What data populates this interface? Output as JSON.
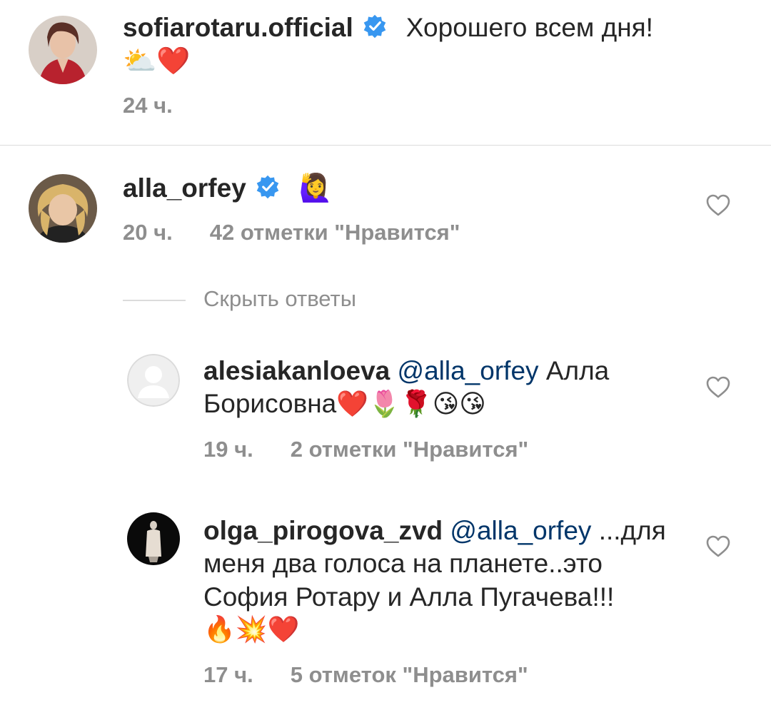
{
  "post": {
    "username": "sofiarotaru.official",
    "caption": "Хорошего всем дня!",
    "caption_emoji": "⛅❤️",
    "time": "24 ч."
  },
  "comment": {
    "username": "alla_orfey",
    "emoji": "🙋‍♀️",
    "time": "20 ч.",
    "likes": "42 отметки \"Нравится\""
  },
  "hide_replies": "Скрыть ответы",
  "replies": [
    {
      "username": "alesiakanloeva",
      "mention": "@alla_orfey",
      "text_line1": "Алла",
      "text_line2": "Борисовна",
      "emoji": "❤️🌷🌹😘😘",
      "time": "19 ч.",
      "likes": "2 отметки \"Нравится\""
    },
    {
      "username": "olga_pirogova_zvd",
      "mention": "@alla_orfey",
      "text_line1": "...для",
      "text_line2": "меня два голоса на планете..это",
      "text_line3": "София Ротару и Алла Пугачева!!!",
      "emoji": "🔥💥❤️",
      "time": "17 ч.",
      "likes": "5 отметок \"Нравится\""
    }
  ],
  "icons": {
    "verified": "verified-badge-icon",
    "like": "heart-outline-icon"
  },
  "colors": {
    "verified": "#3897f0",
    "mention": "#003569",
    "secondary_text": "#8e8e8e",
    "divider": "#dbdbdb"
  }
}
